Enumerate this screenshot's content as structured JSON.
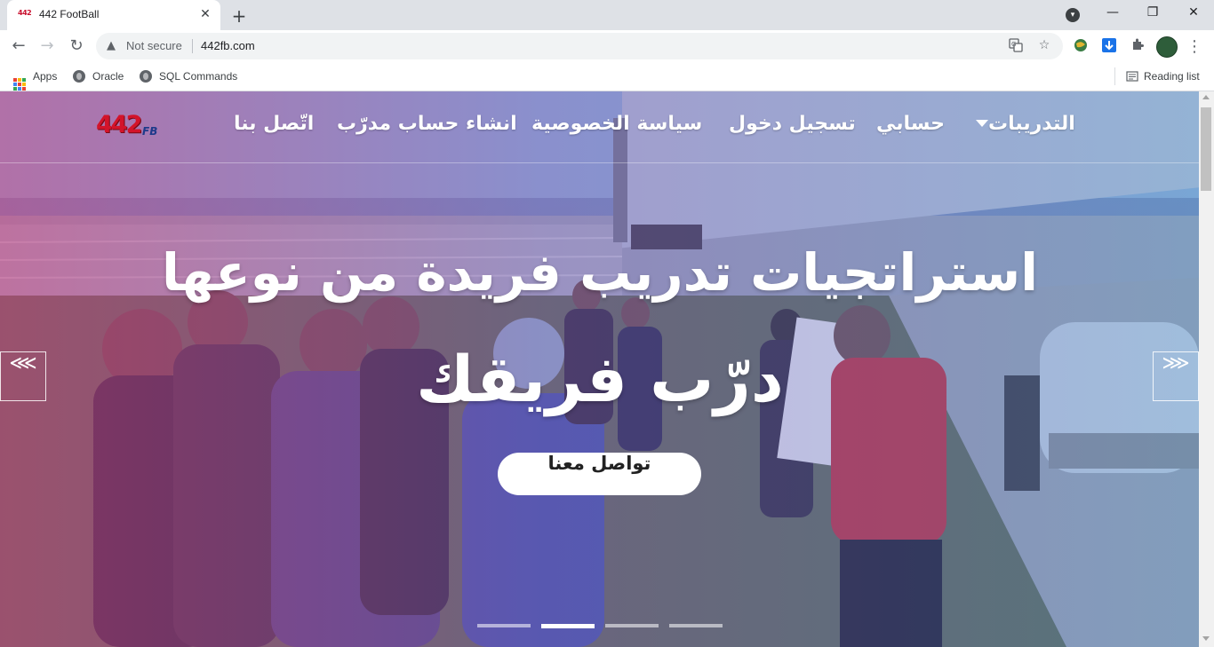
{
  "browser": {
    "tab": {
      "favicon_text": "442",
      "title": "442 FootBall",
      "close_glyph": "✕"
    },
    "new_tab_glyph": "+",
    "window_controls": {
      "minimize": "—",
      "restore": "❐",
      "close": "✕"
    },
    "toolbar": {
      "back": "←",
      "forward": "→",
      "reload": "↻",
      "security_icon": "▲",
      "security_text": "Not secure",
      "url": "442fb.com",
      "translate_icon": "translate-icon",
      "star_icon": "☆",
      "extensions_icon": "puzzle-icon",
      "menu_glyph": "⋮"
    },
    "bookmarks": [
      {
        "label": "Apps",
        "icon": "apps-grid-icon"
      },
      {
        "label": "Oracle",
        "icon": "globe-icon"
      },
      {
        "label": "SQL Commands",
        "icon": "globe-icon"
      }
    ],
    "reading_list": "Reading list"
  },
  "site": {
    "logo": {
      "main": "442",
      "sub": "FB"
    },
    "nav": [
      {
        "label": "التدريبات",
        "has_dropdown": true
      },
      {
        "label": "حسابي"
      },
      {
        "label": "تسجيل دخول"
      },
      {
        "label": "سياسة الخصوصية"
      },
      {
        "label": "انشاء حساب مدرّب"
      },
      {
        "label": "اتّصل بنا"
      }
    ],
    "hero": {
      "title": "استراتجيات تدريب فريدة من نوعها",
      "subtitle": "درّب فريقك",
      "cta": "تواصل معنا",
      "prev_glyph": "⋘",
      "next_glyph": "⋙",
      "slide_count": 4,
      "active_slide": 2
    }
  },
  "colors": {
    "overlay_pink": "#cd3c82",
    "overlay_blue": "#468cd2",
    "logo_red": "#d3142a",
    "logo_blue": "#1e3a8a"
  }
}
